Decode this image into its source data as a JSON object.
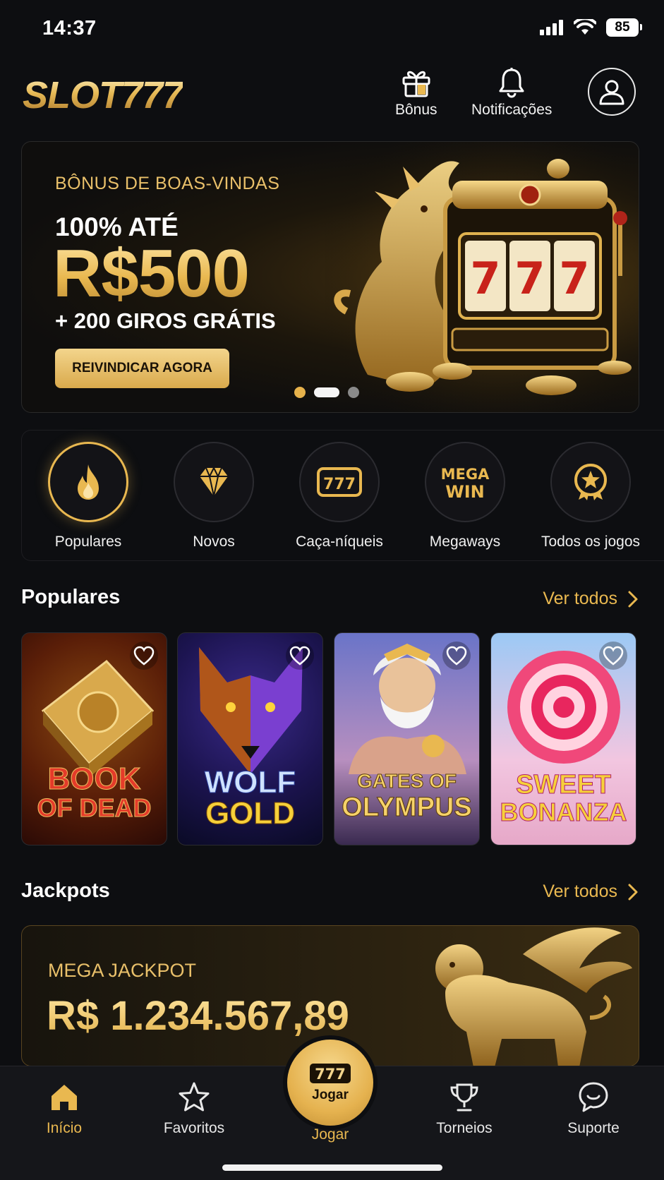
{
  "status_bar": {
    "time": "14:37",
    "battery": "85"
  },
  "header": {
    "logo": "SLOT777",
    "bonus_label": "Bônus",
    "notifications_label": "Notificações"
  },
  "banner": {
    "kicker": "BÔNUS DE BOAS-VINDAS",
    "line1": "100% ATÉ",
    "amount": "R$500",
    "line2": "+ 200 GIROS GRÁTIS",
    "cta": "REIVINDICAR AGORA",
    "slot_symbols": "7 7 7",
    "pagination": {
      "count": 3,
      "active": 2
    }
  },
  "categories": [
    {
      "label": "Populares",
      "icon": "flame-icon",
      "active": true
    },
    {
      "label": "Novos",
      "icon": "diamond-icon",
      "active": false
    },
    {
      "label": "Caça-níqueis",
      "icon": "slot-777-icon",
      "active": false
    },
    {
      "label": "Megaways",
      "icon": "mega-win-icon",
      "active": false
    },
    {
      "label": "Todos os jogos",
      "icon": "star-badge-icon",
      "active": false
    }
  ],
  "category_icon_text": {
    "slot": "777",
    "mega": "MEGA",
    "win": "WIN"
  },
  "popular": {
    "title": "Populares",
    "see_all": "Ver todos",
    "games": [
      {
        "title_top": "BOOK",
        "title_bottom": "OF DEAD",
        "name": "Book of Dead"
      },
      {
        "title_top": "WOLF",
        "title_bottom": "GOLD",
        "name": "Wolf Gold"
      },
      {
        "title_top": "GATES OF",
        "title_bottom": "OLYMPUS",
        "name": "Gates of Olympus"
      },
      {
        "title_top": "SWEET",
        "title_bottom": "BONANZA",
        "name": "Sweet Bonanza"
      }
    ]
  },
  "jackpots": {
    "title": "Jackpots",
    "see_all": "Ver todos",
    "label": "MEGA JACKPOT",
    "value": "R$ 1.234.567,89"
  },
  "tabbar": {
    "home": "Início",
    "favorites": "Favoritos",
    "play_fab": "Jogar",
    "play_fab_reels": "777",
    "play": "Jogar",
    "tournaments": "Torneios",
    "support": "Suporte"
  },
  "colors": {
    "accent": "#e9b850",
    "background": "#0d0e11",
    "tabbar": "#15161a"
  }
}
